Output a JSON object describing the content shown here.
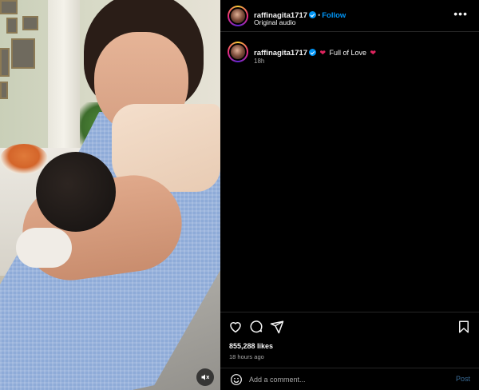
{
  "post": {
    "author": "raffinagita1717",
    "follow_label": "Follow",
    "separator": "•",
    "audio_label": "Original audio",
    "more_label": "•••"
  },
  "caption": {
    "username": "raffinagita1717",
    "text": "Full of Love",
    "heart_emoji": "❤",
    "time": "18h"
  },
  "stats": {
    "likes": "855,288 likes",
    "posted": "18 hours ago"
  },
  "comment": {
    "placeholder": "Add a comment...",
    "post_label": "Post"
  },
  "colors": {
    "accent": "#0095f6",
    "heart": "#e0245e",
    "background": "#000000",
    "muted_text": "#a8a8a8"
  },
  "icons": [
    "mute-icon",
    "more-icon",
    "heart-icon",
    "comment-icon",
    "share-icon",
    "bookmark-icon",
    "emoji-icon",
    "verified-icon"
  ]
}
